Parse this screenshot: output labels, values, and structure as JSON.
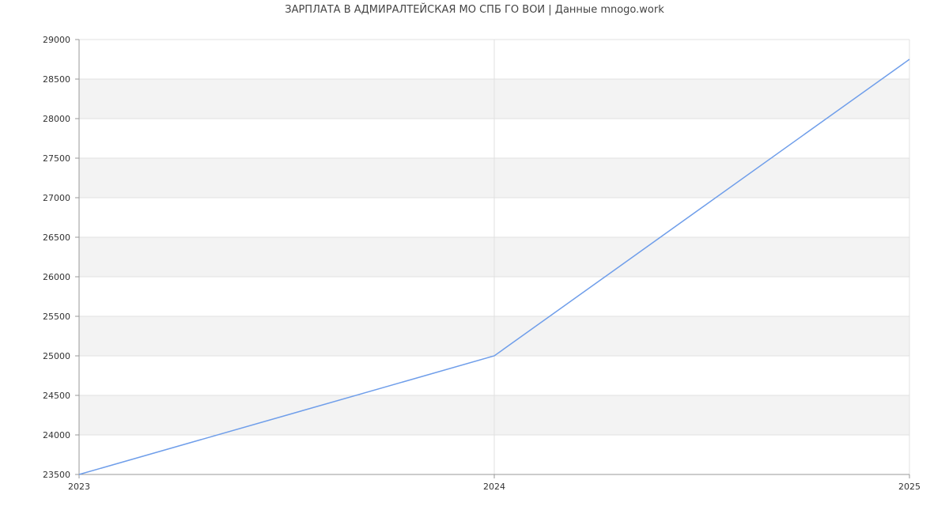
{
  "chart_data": {
    "type": "line",
    "title": "ЗАРПЛАТА В АДМИРАЛТЕЙСКАЯ МО СПБ ГО ВОИ | Данные mnogo.work",
    "xlabel": "",
    "ylabel": "",
    "x": [
      2023,
      2024,
      2025
    ],
    "x_tick_labels": [
      "2023",
      "2024",
      "2025"
    ],
    "xlim": [
      2023,
      2025
    ],
    "ylim": [
      23500,
      29000
    ],
    "y_ticks": [
      23500,
      24000,
      24500,
      25000,
      25500,
      26000,
      26500,
      27000,
      27500,
      28000,
      28500,
      29000
    ],
    "y_tick_labels": [
      "23500",
      "24000",
      "24500",
      "25000",
      "25500",
      "26000",
      "26500",
      "27000",
      "27500",
      "28000",
      "28500",
      "29000"
    ],
    "series": [
      {
        "values": [
          23500,
          25000,
          28750
        ]
      }
    ],
    "grid": true,
    "legend": "none",
    "colors": {
      "line": "#6f9eea",
      "band": "#f3f3f3",
      "grid": "#e0e0e0",
      "axis": "#999999"
    }
  }
}
